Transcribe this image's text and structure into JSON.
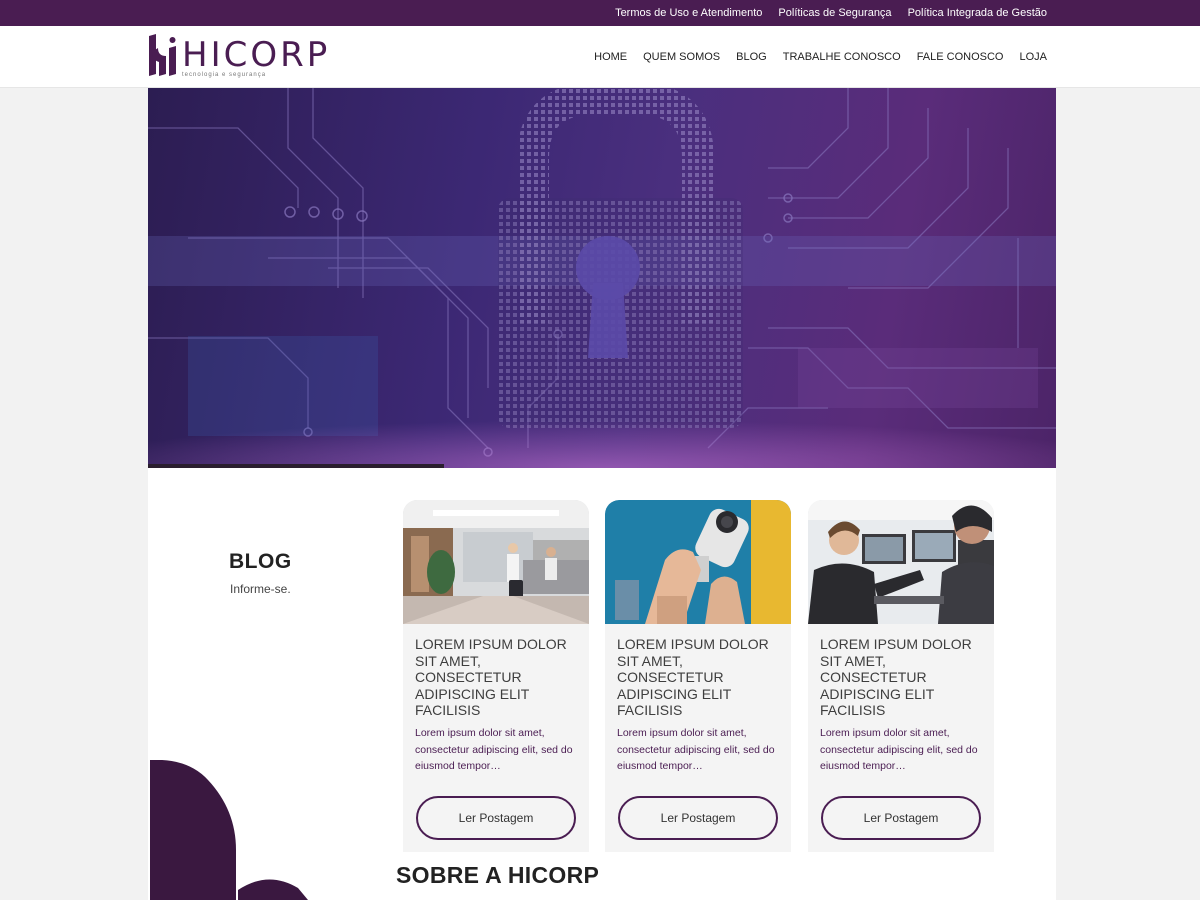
{
  "topbar": {
    "links": [
      "Termos de Uso e Atendimento",
      "Políticas de Segurança",
      "Política Integrada de Gestão"
    ]
  },
  "brand": {
    "name": "HICORP",
    "tagline": "tecnologia e segurança",
    "color": "#4a1d52"
  },
  "nav": {
    "items": [
      "HOME",
      "QUEM SOMOS",
      "BLOG",
      "TRABALHE CONOSCO",
      "FALE CONOSCO",
      "LOJA"
    ]
  },
  "hero": {
    "image": "padlock-circuit-icon"
  },
  "blog": {
    "heading": "BLOG",
    "subheading": "Informe-se.",
    "cards": [
      {
        "image": "hotel-lobby-photo",
        "title": "LOREM IPSUM DOLOR SIT AMET, CONSECTETUR ADIPISCING ELIT FACILISIS",
        "excerpt": "Lorem ipsum dolor sit amet, consectetur adipiscing elit, sed do eiusmod tempor…",
        "button": "Ler Postagem"
      },
      {
        "image": "security-camera-installation-photo",
        "title": "LOREM IPSUM DOLOR SIT AMET, CONSECTETUR ADIPISCING ELIT FACILISIS",
        "excerpt": "Lorem ipsum dolor sit amet, consectetur adipiscing elit, sed do eiusmod tempor…",
        "button": "Ler Postagem"
      },
      {
        "image": "security-monitoring-room-photo",
        "title": "LOREM IPSUM DOLOR SIT AMET, CONSECTETUR ADIPISCING ELIT FACILISIS",
        "excerpt": "Lorem ipsum dolor sit amet, consectetur adipiscing elit, sed do eiusmod tempor…",
        "button": "Ler Postagem"
      }
    ]
  },
  "about": {
    "title": "SOBRE A HICORP"
  }
}
